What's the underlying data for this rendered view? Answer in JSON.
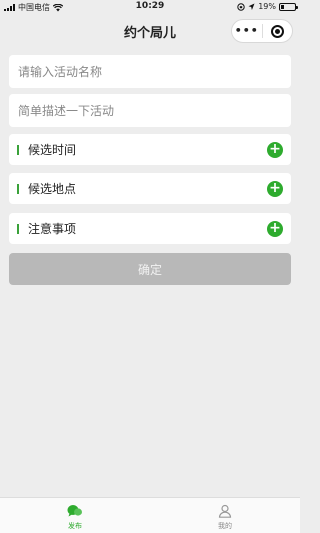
{
  "status": {
    "carrier": "中国电信",
    "time": "10:29",
    "battery": "19%",
    "battery_level": 0.19
  },
  "nav": {
    "title": "约个局儿",
    "more_glyph": "•••"
  },
  "form": {
    "name_placeholder": "请输入活动名称",
    "name_value": "",
    "desc_placeholder": "简单描述一下活动",
    "desc_value": ""
  },
  "sections": [
    {
      "label": "候选时间"
    },
    {
      "label": "候选地点"
    },
    {
      "label": "注意事项"
    }
  ],
  "confirm_label": "确定",
  "tabbar": {
    "tabs": [
      {
        "label": "发布",
        "icon": "chat-bubbles-icon",
        "active": true
      },
      {
        "label": "我的",
        "icon": "person-icon",
        "active": false
      }
    ]
  },
  "colors": {
    "accent": "#2eab2e",
    "disabled_button": "#b8b8b8",
    "background": "#ededed"
  }
}
